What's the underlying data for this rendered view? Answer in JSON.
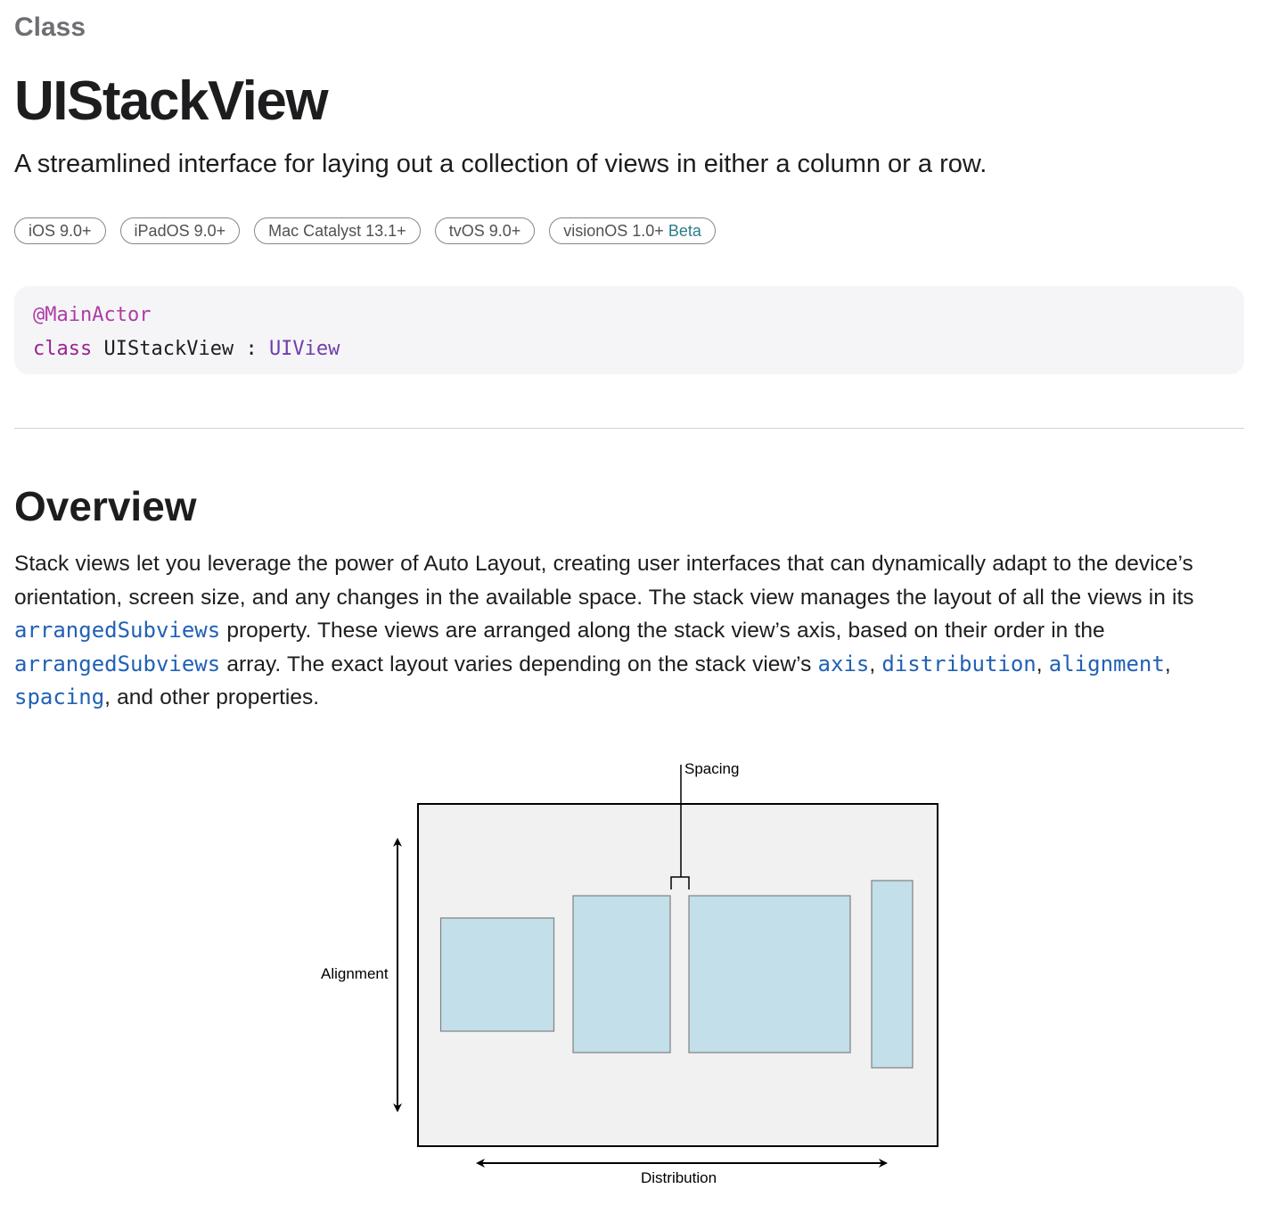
{
  "header": {
    "eyebrow": "Class",
    "title": "UIStackView",
    "abstract": "A streamlined interface for laying out a collection of views in either a column or a row."
  },
  "platforms": [
    {
      "label": "iOS 9.0+",
      "badge": ""
    },
    {
      "label": "iPadOS 9.0+",
      "badge": ""
    },
    {
      "label": "Mac Catalyst 13.1+",
      "badge": ""
    },
    {
      "label": "tvOS 9.0+",
      "badge": ""
    },
    {
      "label": "visionOS 1.0+",
      "badge": "Beta"
    }
  ],
  "declaration": {
    "attribute": "@MainActor",
    "keyword": "class",
    "name": "UIStackView",
    "colon": ":",
    "superclass": "UIView"
  },
  "overview": {
    "heading": "Overview",
    "t1": "Stack views let you leverage the power of Auto Layout, creating user interfaces that can dynamically adapt to the device’s orientation, screen size, and any changes in the available space. The stack view manages the layout of all the views in its ",
    "link1": "arrangedSubviews",
    "t2": " property. These views are arranged along the stack view’s axis, based on their order in the ",
    "link2": "arrangedSubviews",
    "t3": " array. The exact layout varies depending on the stack view’s ",
    "link3": "axis",
    "t4": ", ",
    "link4": "distribution",
    "t5": ", ",
    "link5": "alignment",
    "t6": ", ",
    "link6": "spacing",
    "t7": ", and other properties."
  },
  "figure": {
    "spacing_label": "Spacing",
    "alignment_label": "Alignment",
    "distribution_label": "Distribution"
  },
  "colors": {
    "link": "#2161b5",
    "attribute": "#ad3da4",
    "keyword": "#9b2393",
    "type": "#703daa",
    "box_fill": "#c2dfea",
    "container_fill": "#f1f1f1"
  }
}
